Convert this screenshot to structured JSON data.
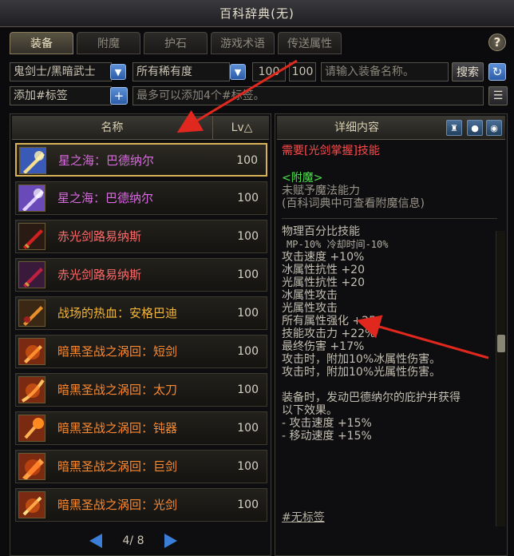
{
  "window": {
    "title": "百科辞典(无)"
  },
  "tabs": [
    {
      "label": "装备",
      "active": true
    },
    {
      "label": "附魔",
      "active": false
    },
    {
      "label": "护石",
      "active": false
    },
    {
      "label": "游戏术语",
      "active": false
    },
    {
      "label": "传送属性",
      "active": false
    }
  ],
  "help_label": "?",
  "filters": {
    "class_select": "鬼剑士/黑暗武士",
    "rarity_select": "所有稀有度",
    "level_min": "100",
    "level_max": "100",
    "search_placeholder": "请输入装备名称。",
    "search_button": "搜索",
    "tag_select": "添加#标签",
    "tag_hint": "最多可以添加4个#标签。"
  },
  "list": {
    "header_name": "名称",
    "header_lv": "Lv△",
    "items": [
      {
        "name": "星之海：巴德纳尔",
        "lv": "100",
        "rarity_color": "#d96ae0",
        "icon": "star-sea-sword-icon",
        "selected": true
      },
      {
        "name": "星之海：巴德纳尔",
        "lv": "100",
        "rarity_color": "#d96ae0",
        "icon": "star-sea-sword-icon",
        "selected": false
      },
      {
        "name": "赤光剑路易纳斯",
        "lv": "100",
        "rarity_color": "#ff6a6a",
        "icon": "red-light-sword-icon",
        "selected": false
      },
      {
        "name": "赤光剑路易纳斯",
        "lv": "100",
        "rarity_color": "#ff6a6a",
        "icon": "red-light-sword-icon",
        "selected": false
      },
      {
        "name": "战场的热血：安格巴迪",
        "lv": "100",
        "rarity_color": "#f2b63c",
        "icon": "battlefield-blade-icon",
        "selected": false
      },
      {
        "name": "暗黑圣战之涡回：短剑",
        "lv": "100",
        "rarity_color": "#ff8a2e",
        "icon": "dark-crusade-dagger-icon",
        "selected": false
      },
      {
        "name": "暗黑圣战之涡回：太刀",
        "lv": "100",
        "rarity_color": "#ff8a2e",
        "icon": "dark-crusade-katana-icon",
        "selected": false
      },
      {
        "name": "暗黑圣战之涡回：钝器",
        "lv": "100",
        "rarity_color": "#ff8a2e",
        "icon": "dark-crusade-club-icon",
        "selected": false
      },
      {
        "name": "暗黑圣战之涡回：巨剑",
        "lv": "100",
        "rarity_color": "#ff8a2e",
        "icon": "dark-crusade-greatsword-icon",
        "selected": false
      },
      {
        "name": "暗黑圣战之涡回：光剑",
        "lv": "100",
        "rarity_color": "#ff8a2e",
        "icon": "dark-crusade-beamsword-icon",
        "selected": false
      }
    ]
  },
  "pager": {
    "text": "4/ 8"
  },
  "detail": {
    "header": "详细内容",
    "requirement": "需要[光剑掌握]技能",
    "enchant_title": "<附魔>",
    "enchant_line1": "未赋予魔法能力",
    "enchant_line2": "(百科词典中可查看附魔信息)",
    "skill_type": "物理百分比技能",
    "mp_cd": "MP-10% 冷却时间-10%",
    "stats": [
      "攻击速度 +10%",
      "冰属性抗性 +20",
      "光属性抗性 +20",
      "冰属性攻击",
      "光属性攻击",
      "所有属性强化 +25",
      "技能攻击力 +22%",
      "最终伤害 +17%",
      "攻击时，附加10%冰属性伤害。",
      "攻击时，附加10%光属性伤害。"
    ],
    "effect_intro1": "装备时，发动巴德纳尔的庇护并获得",
    "effect_intro2": "以下效果。",
    "effect1": "- 攻击速度 +15%",
    "effect2": "- 移动速度 +15%",
    "tag": "#无标签"
  },
  "colors": {
    "arrow": "#e0281e",
    "accent": "#d8b256",
    "blue_button": "#3b7ed8"
  }
}
